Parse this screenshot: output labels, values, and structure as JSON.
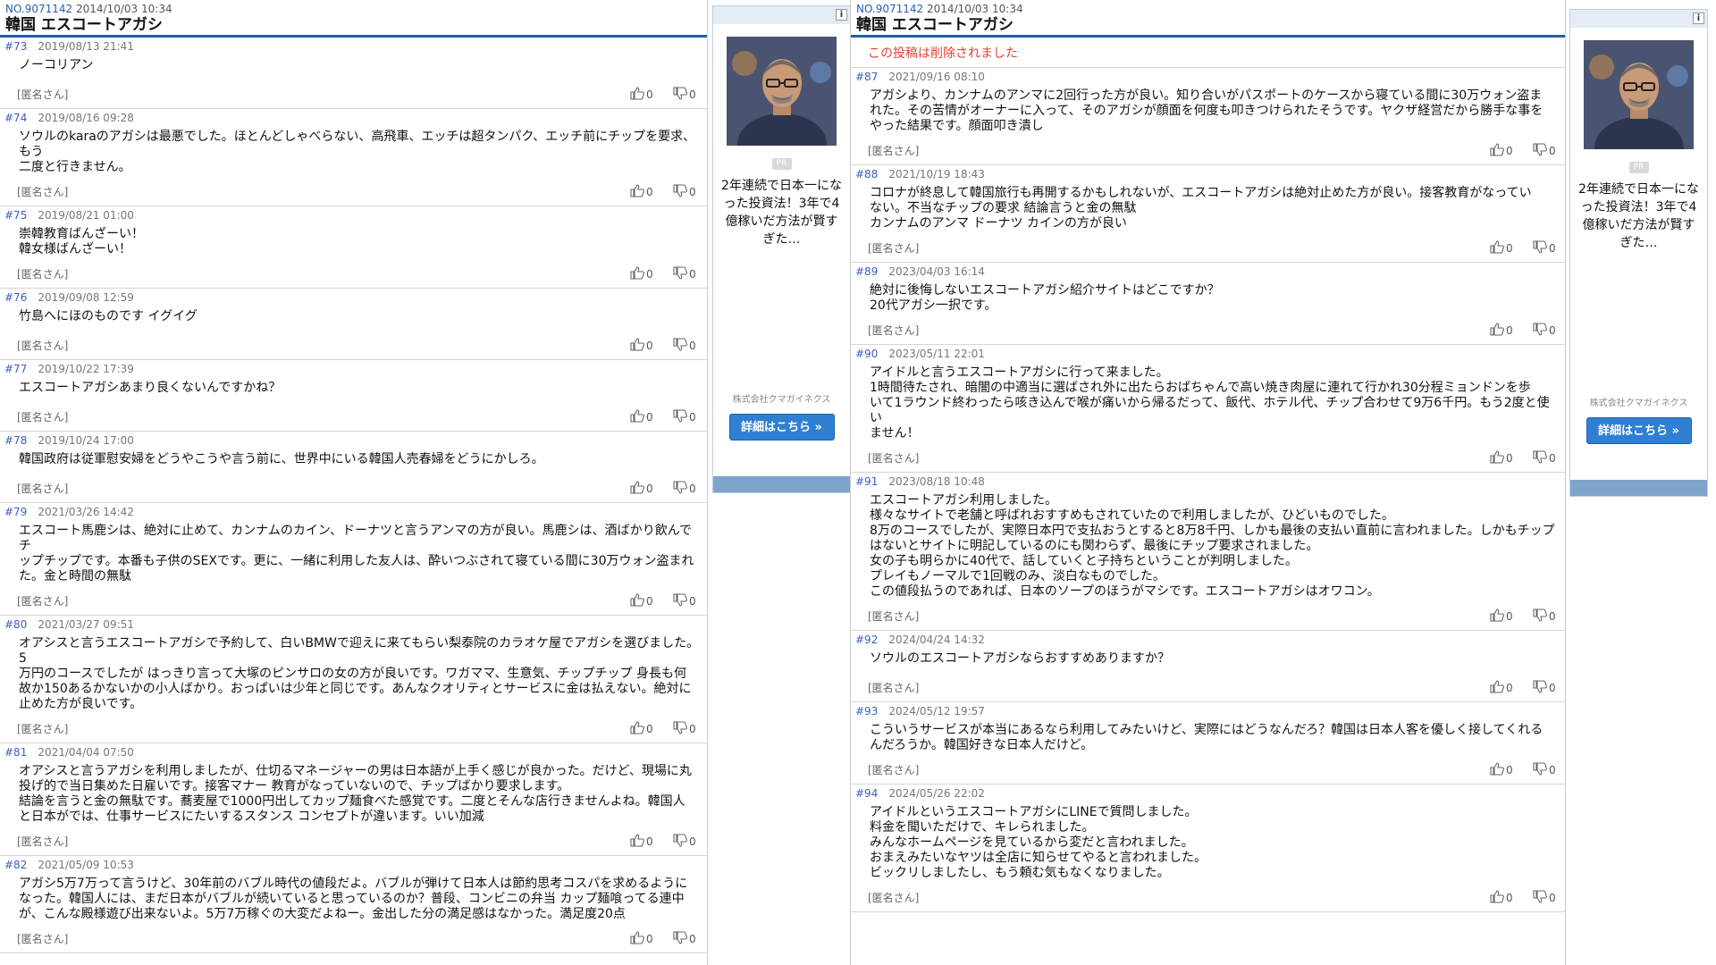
{
  "left": {
    "meta_no": "NO.9071142",
    "meta_date": "2014/10/03 10:34",
    "title": "韓国 エスコートアガシ",
    "posts": [
      {
        "num": "#73",
        "date": "2019/08/13 21:41",
        "body": "ノーコリアン",
        "anon": "[匿名さん]",
        "up": "0",
        "down": "0"
      },
      {
        "num": "#74",
        "date": "2019/08/16 09:28",
        "body": "ソウルのkaraのアガシは最悪でした。ほとんどしゃべらない、高飛車、エッチは超タンパク、エッチ前にチップを要求、もう\n二度と行きません。",
        "anon": "[匿名さん]",
        "up": "0",
        "down": "0"
      },
      {
        "num": "#75",
        "date": "2019/08/21 01:00",
        "body": "崇韓教育ばんざーい！\n韓女様ばんざーい！",
        "anon": "[匿名さん]",
        "up": "0",
        "down": "0"
      },
      {
        "num": "#76",
        "date": "2019/09/08 12:59",
        "body": "竹島へにほのものです イグイグ",
        "anon": "[匿名さん]",
        "up": "0",
        "down": "0"
      },
      {
        "num": "#77",
        "date": "2019/10/22 17:39",
        "body": "エスコートアガシあまり良くないんですかね？",
        "anon": "[匿名さん]",
        "up": "0",
        "down": "0"
      },
      {
        "num": "#78",
        "date": "2019/10/24 17:00",
        "body": "韓国政府は従軍慰安婦をどうやこうや言う前に、世界中にいる韓国人売春婦をどうにかしろ。",
        "anon": "[匿名さん]",
        "up": "0",
        "down": "0"
      },
      {
        "num": "#79",
        "date": "2021/03/26 14:42",
        "body": "エスコート馬鹿シは、絶対に止めて、カンナムのカイン、ドーナツと言うアンマの方が良い。馬鹿シは、酒ばかり飲んでチ\nップチップです。本番も子供のSEXです。更に、一緒に利用した友人は、酔いつぶされて寝ている間に30万ウォン盗まれ\nた。金と時間の無駄",
        "anon": "[匿名さん]",
        "up": "0",
        "down": "0"
      },
      {
        "num": "#80",
        "date": "2021/03/27 09:51",
        "body": "オアシスと言うエスコートアガシで予約して、白いBMWで迎えに来てもらい梨泰院のカラオケ屋でアガシを選びました。5\n万円のコースでしたが はっきり言って大塚のピンサロの女の方が良いです。ワガママ、生意気、チップチップ 身長も何\n故か150あるかないかの小人ばかり。おっぱいは少年と同じです。あんなクオリティとサービスに金は払えない。絶対に\n止めた方が良いです。",
        "anon": "[匿名さん]",
        "up": "0",
        "down": "0"
      },
      {
        "num": "#81",
        "date": "2021/04/04 07:50",
        "body": "オアシスと言うアガシを利用しましたが、仕切るマネージャーの男は日本語が上手く感じが良かった。だけど、現場に丸\n投げ的で当日集めた日雇いです。接客マナー 教育がなっていないので、チップばかり要求します。\n結論を言うと金の無駄です。蕎麦屋で1000円出してカップ麺食べた感覚です。二度とそんな店行きませんよね。韓国人\nと日本がでは、仕事サービスにたいするスタンス コンセプトが違います。いい加減",
        "anon": "[匿名さん]",
        "up": "0",
        "down": "0"
      },
      {
        "num": "#82",
        "date": "2021/05/09 10:53",
        "body": "アガシ5万7万って言うけど、30年前のバブル時代の値段だよ。バブルが弾けて日本人は節約思考コスパを求めるように\nなった。韓国人には、まだ日本がバブルが続いていると思っているのか？普段、コンビニの弁当 カップ麺喰ってる連中\nが、こんな殿様遊び出来ないよ。5万7万稼ぐの大変だよねー。金出した分の満足感はなかった。満足度20点",
        "anon": "[匿名さん]",
        "up": "0",
        "down": "0"
      }
    ]
  },
  "right": {
    "meta_no": "NO.9071142",
    "meta_date": "2014/10/03 10:34",
    "title": "韓国 エスコートアガシ",
    "deleted_text": "この投稿は削除されました",
    "posts": [
      {
        "num": "#87",
        "date": "2021/09/16 08:10",
        "body": "アガシより、カンナムのアンマに2回行った方が良い。知り合いがパスポートのケースから寝ている間に30万ウォン盗ま\nれた。その苦情がオーナーに入って、そのアガシが顔面を何度も叩きつけられたそうです。ヤクザ経営だから勝手な事を\nやった結果です。顔面叩き潰し",
        "anon": "[匿名さん]",
        "up": "0",
        "down": "0"
      },
      {
        "num": "#88",
        "date": "2021/10/19 18:43",
        "body": "コロナが終息して韓国旅行も再開するかもしれないが、エスコートアガシは絶対止めた方が良い。接客教育がなってい\nない。不当なチップの要求 結論言うと金の無駄\nカンナムのアンマ ドーナツ カインの方が良い",
        "anon": "[匿名さん]",
        "up": "0",
        "down": "0"
      },
      {
        "num": "#89",
        "date": "2023/04/03 16:14",
        "body": "絶対に後悔しないエスコートアガシ紹介サイトはどこですか？\n20代アガシ一択です。",
        "anon": "[匿名さん]",
        "up": "0",
        "down": "0"
      },
      {
        "num": "#90",
        "date": "2023/05/11 22:01",
        "body": "アイドルと言うエスコートアガシに行って来ました。\n1時間待たされ、暗闇の中適当に選ばされ外に出たらおばちゃんで高い焼き肉屋に連れて行かれ30分程ミョンドンを歩\nいて1ラウンド終わったら咳き込んで喉が痛いから帰るだって、飯代、ホテル代、チップ合わせて9万6千円。もう2度と使い\nません！",
        "anon": "[匿名さん]",
        "up": "0",
        "down": "0"
      },
      {
        "num": "#91",
        "date": "2023/08/18 10:48",
        "body": "エスコートアガシ利用しました。\n様々なサイトで老舗と呼ばれおすすめもされていたので利用しましたが、ひどいものでした。\n8万のコースでしたが、実際日本円で支払おうとすると8万8千円、しかも最後の支払い直前に言われました。しかもチップ\nはないとサイトに明記しているのにも関わらず、最後にチップ要求されました。\n女の子も明らかに40代で、話していくと子持ちということが判明しました。\nプレイもノーマルで1回戦のみ、淡白なものでした。\nこの値段払うのであれば、日本のソープのほうがマシです。エスコートアガシはオワコン。",
        "anon": "[匿名さん]",
        "up": "0",
        "down": "0"
      },
      {
        "num": "#92",
        "date": "2024/04/24 14:32",
        "body": "ソウルのエスコートアガシならおすすめありますか？",
        "anon": "[匿名さん]",
        "up": "0",
        "down": "0"
      },
      {
        "num": "#93",
        "date": "2024/05/12 19:57",
        "body": "こういうサービスが本当にあるなら利用してみたいけど、実際にはどうなんだろ？韓国は日本人客を優しく接してくれる\nんだろうか。韓国好きな日本人だけど。",
        "anon": "[匿名さん]",
        "up": "0",
        "down": "0"
      },
      {
        "num": "#94",
        "date": "2024/05/26 22:02",
        "body": "アイドルというエスコートアガシにLINEで質問しました。\n料金を聞いただけで、キレられました。\nみんなホームページを見ているから変だと言われました。\nおまえみたいなヤツは全店に知らせてやると言われました。\nビックリしましたし、もう頼む気もなくなりました。",
        "anon": "[匿名さん]",
        "up": "0",
        "down": "0"
      }
    ]
  },
  "ad": {
    "pr_label": "PR",
    "info_label": "i",
    "text": "2年連続で日本一になった投資法！3年で4億稼いだ方法が賢すぎた…",
    "company": "株式会社クマガイネクス",
    "cta": "詳細はこちら »"
  },
  "colors": {
    "accent": "#1f5fa6",
    "link": "#3a5fbf",
    "deleted": "#e0403a",
    "cta": "#2f7fd3"
  }
}
